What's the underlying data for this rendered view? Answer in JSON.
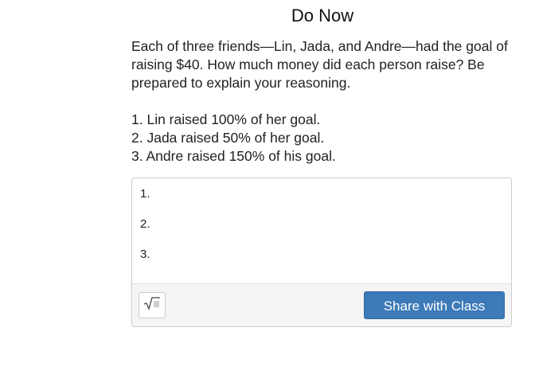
{
  "header": {
    "title": "Do Now"
  },
  "prompt": {
    "question": "Each of three friends—Lin, Jada, and Andre—had the goal of raising $40. How much money did each person raise? Be prepared to explain your reasoning.",
    "items": [
      "1. Lin raised 100% of her goal.",
      "2. Jada raised 50% of her goal.",
      "3. Andre raised 150% of his goal."
    ]
  },
  "answer": {
    "lines": [
      "1.",
      "2.",
      "3."
    ]
  },
  "toolbar": {
    "math_icon": "square-root-icon",
    "share_label": "Share with Class",
    "share_color": "#3d7ab8"
  }
}
